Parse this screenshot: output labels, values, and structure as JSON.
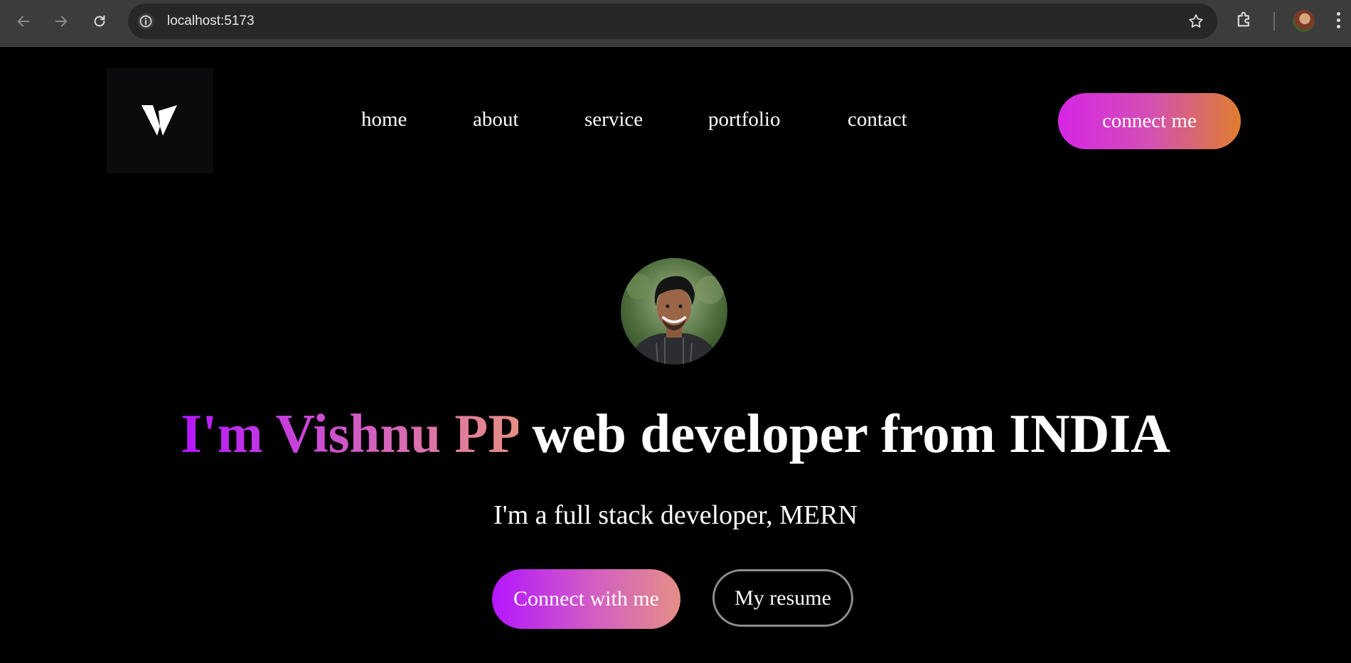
{
  "browser": {
    "url": "localhost:5173",
    "icons": {
      "back": "arrow-left-icon",
      "forward": "arrow-right-icon",
      "reload": "reload-icon",
      "site_info": "info-icon",
      "bookmark": "star-icon",
      "extensions": "puzzle-icon",
      "menu": "more-vertical-icon"
    }
  },
  "header": {
    "logo_letter": "V",
    "nav": [
      {
        "label": "home"
      },
      {
        "label": "about"
      },
      {
        "label": "service"
      },
      {
        "label": "portfolio"
      },
      {
        "label": "contact"
      }
    ],
    "cta_label": "connect me"
  },
  "hero": {
    "name_highlight": "I'm Vishnu PP",
    "headline_rest": "web developer from INDIA",
    "subtitle": "I'm a full stack developer, MERN",
    "primary_button": "Connect with me",
    "secondary_button": "My resume"
  },
  "colors": {
    "background": "#000000",
    "gradient_start": "#b416fe",
    "gradient_mid": "#d35fc2",
    "gradient_end": "#e78f83",
    "cta_gradient_start": "#d625e6",
    "cta_gradient_end": "#de7e2e"
  }
}
